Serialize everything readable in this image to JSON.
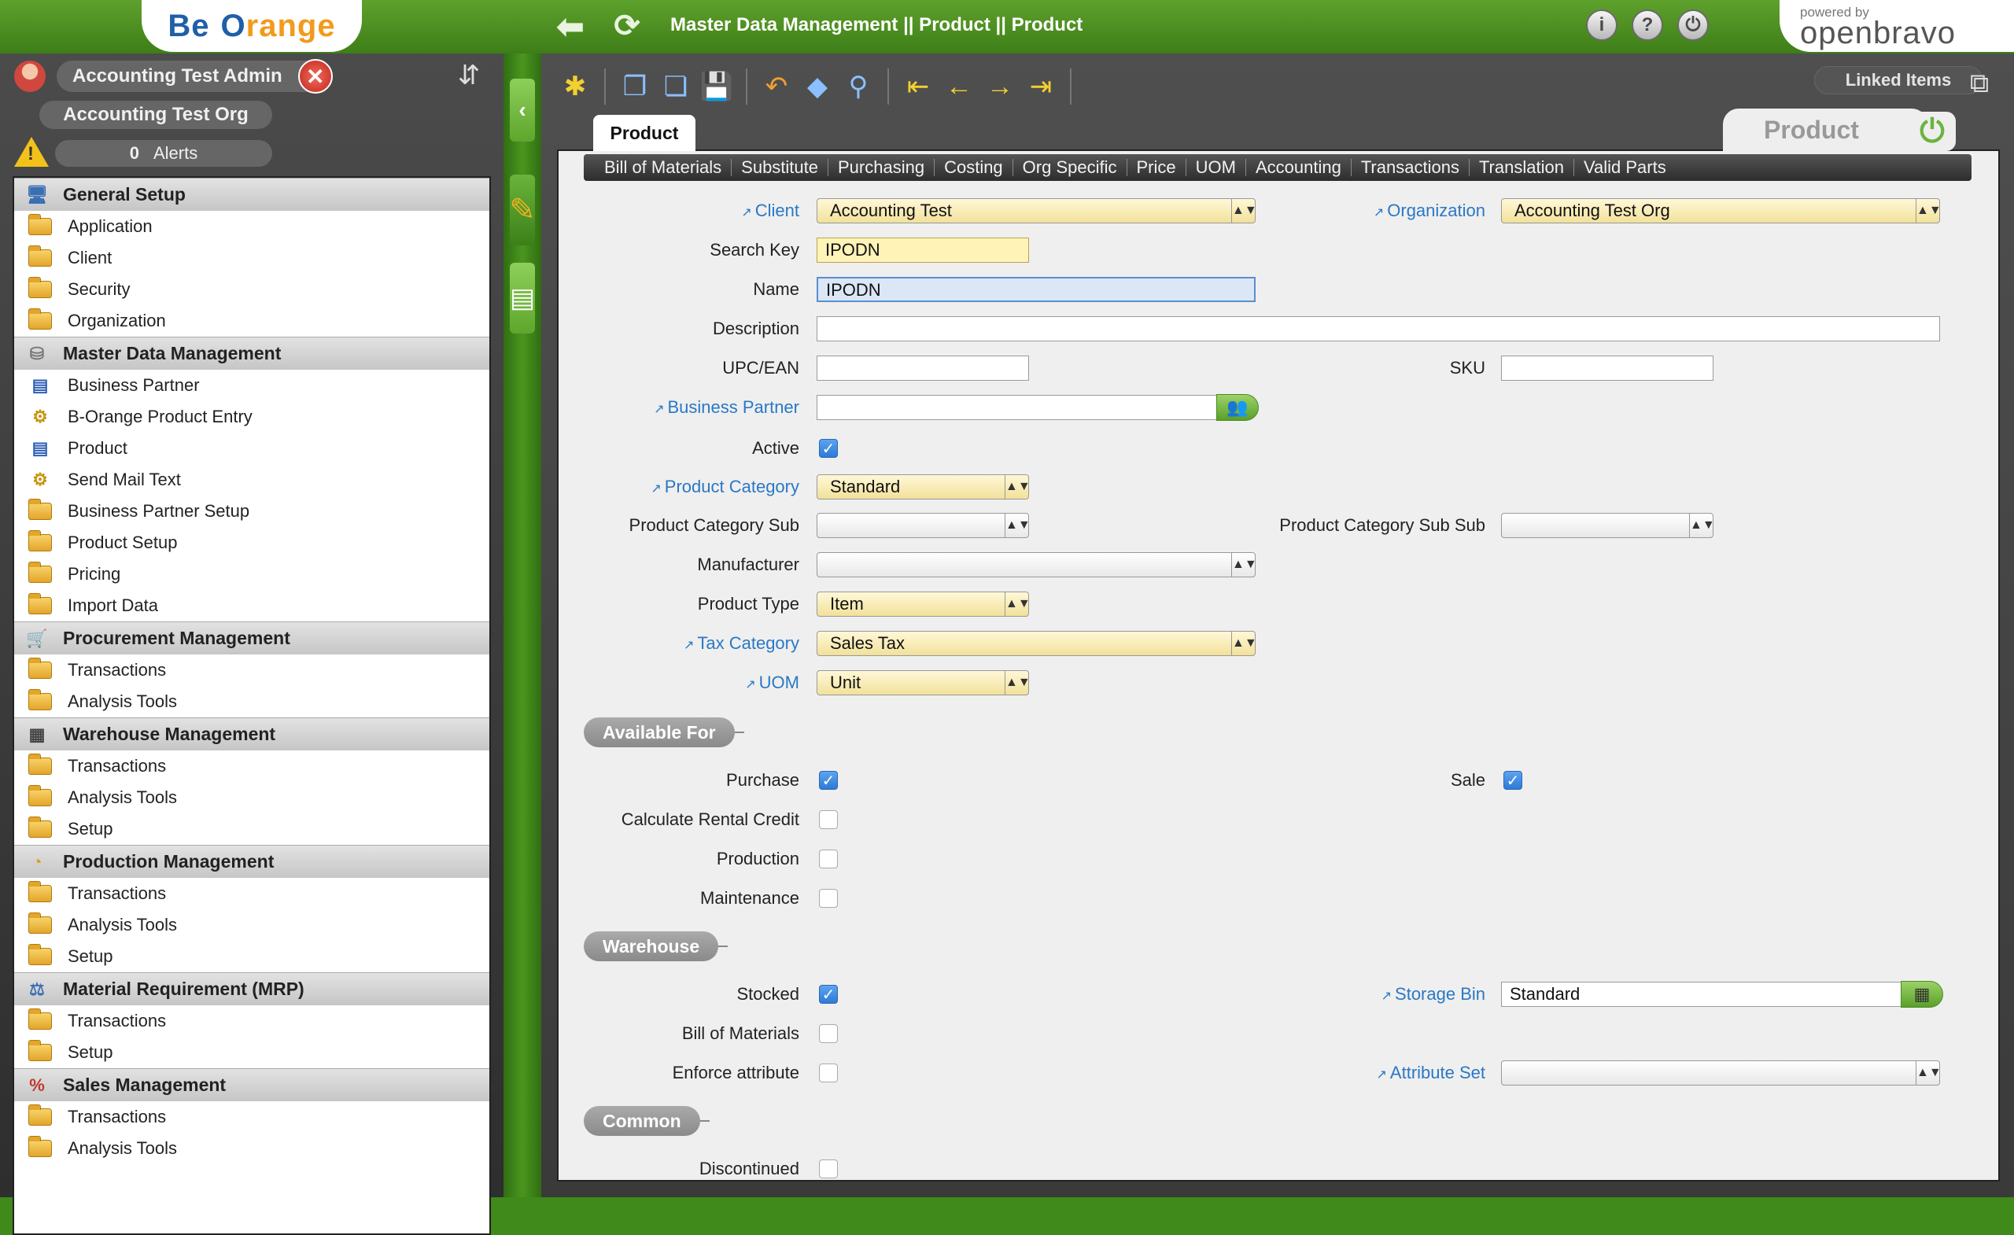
{
  "app": {
    "logo_be": "Be",
    "logo_orange_o": "O",
    "logo_orange_rest": "range",
    "breadcrumb": "Master Data Management || Product || Product",
    "powered_by": "powered by",
    "openbravo": "openbravo"
  },
  "session": {
    "user": "Accounting Test Admin",
    "org": "Accounting Test Org",
    "alerts_count": "0",
    "alerts_label": "Alerts"
  },
  "menu": [
    {
      "section": "General Setup",
      "items": [
        "Application",
        "Client",
        "Security",
        "Organization"
      ]
    },
    {
      "section": "Master Data Management",
      "items": [
        "Business Partner",
        "B-Orange Product Entry",
        "Product",
        "Send Mail Text",
        "Business Partner Setup",
        "Product Setup",
        "Pricing",
        "Import Data"
      ]
    },
    {
      "section": "Procurement Management",
      "items": [
        "Transactions",
        "Analysis Tools"
      ]
    },
    {
      "section": "Warehouse Management",
      "items": [
        "Transactions",
        "Analysis Tools",
        "Setup"
      ]
    },
    {
      "section": "Production Management",
      "items": [
        "Transactions",
        "Analysis Tools",
        "Setup"
      ]
    },
    {
      "section": "Material Requirement (MRP)",
      "items": [
        "Transactions",
        "Setup"
      ]
    },
    {
      "section": "Sales Management",
      "items": [
        "Transactions",
        "Analysis Tools"
      ]
    }
  ],
  "toolbar": {
    "linked_items": "Linked Items"
  },
  "tabs": {
    "active": "Product",
    "window_title": "Product",
    "subtabs": [
      "Bill of Materials",
      "Substitute",
      "Purchasing",
      "Costing",
      "Org Specific",
      "Price",
      "UOM",
      "Accounting",
      "Transactions",
      "Translation",
      "Valid Parts"
    ]
  },
  "form": {
    "client_label": "Client",
    "client_value": "Accounting Test",
    "organization_label": "Organization",
    "organization_value": "Accounting Test Org",
    "search_key_label": "Search Key",
    "search_key_value": "IPODN",
    "name_label": "Name",
    "name_value": "IPODN",
    "description_label": "Description",
    "description_value": "",
    "upc_label": "UPC/EAN",
    "upc_value": "",
    "sku_label": "SKU",
    "sku_value": "",
    "business_partner_label": "Business Partner",
    "business_partner_value": "",
    "active_label": "Active",
    "product_category_label": "Product Category",
    "product_category_value": "Standard",
    "product_category_sub_label": "Product Category Sub",
    "product_category_sub_value": "",
    "product_category_sub_sub_label": "Product Category Sub Sub",
    "product_category_sub_sub_value": "",
    "manufacturer_label": "Manufacturer",
    "manufacturer_value": "",
    "product_type_label": "Product Type",
    "product_type_value": "Item",
    "tax_category_label": "Tax Category",
    "tax_category_value": "Sales Tax",
    "uom_label": "UOM",
    "uom_value": "Unit",
    "available_for_heading": "Available For",
    "purchase_label": "Purchase",
    "sale_label": "Sale",
    "rental_label": "Calculate Rental Credit",
    "production_label": "Production",
    "maintenance_label": "Maintenance",
    "warehouse_heading": "Warehouse",
    "stocked_label": "Stocked",
    "storage_bin_label": "Storage Bin",
    "storage_bin_value": "Standard",
    "bom_label": "Bill of Materials",
    "enforce_label": "Enforce attribute",
    "attribute_set_label": "Attribute Set",
    "attribute_set_value": "",
    "common_heading": "Common",
    "discontinued_label": "Discontinued"
  }
}
